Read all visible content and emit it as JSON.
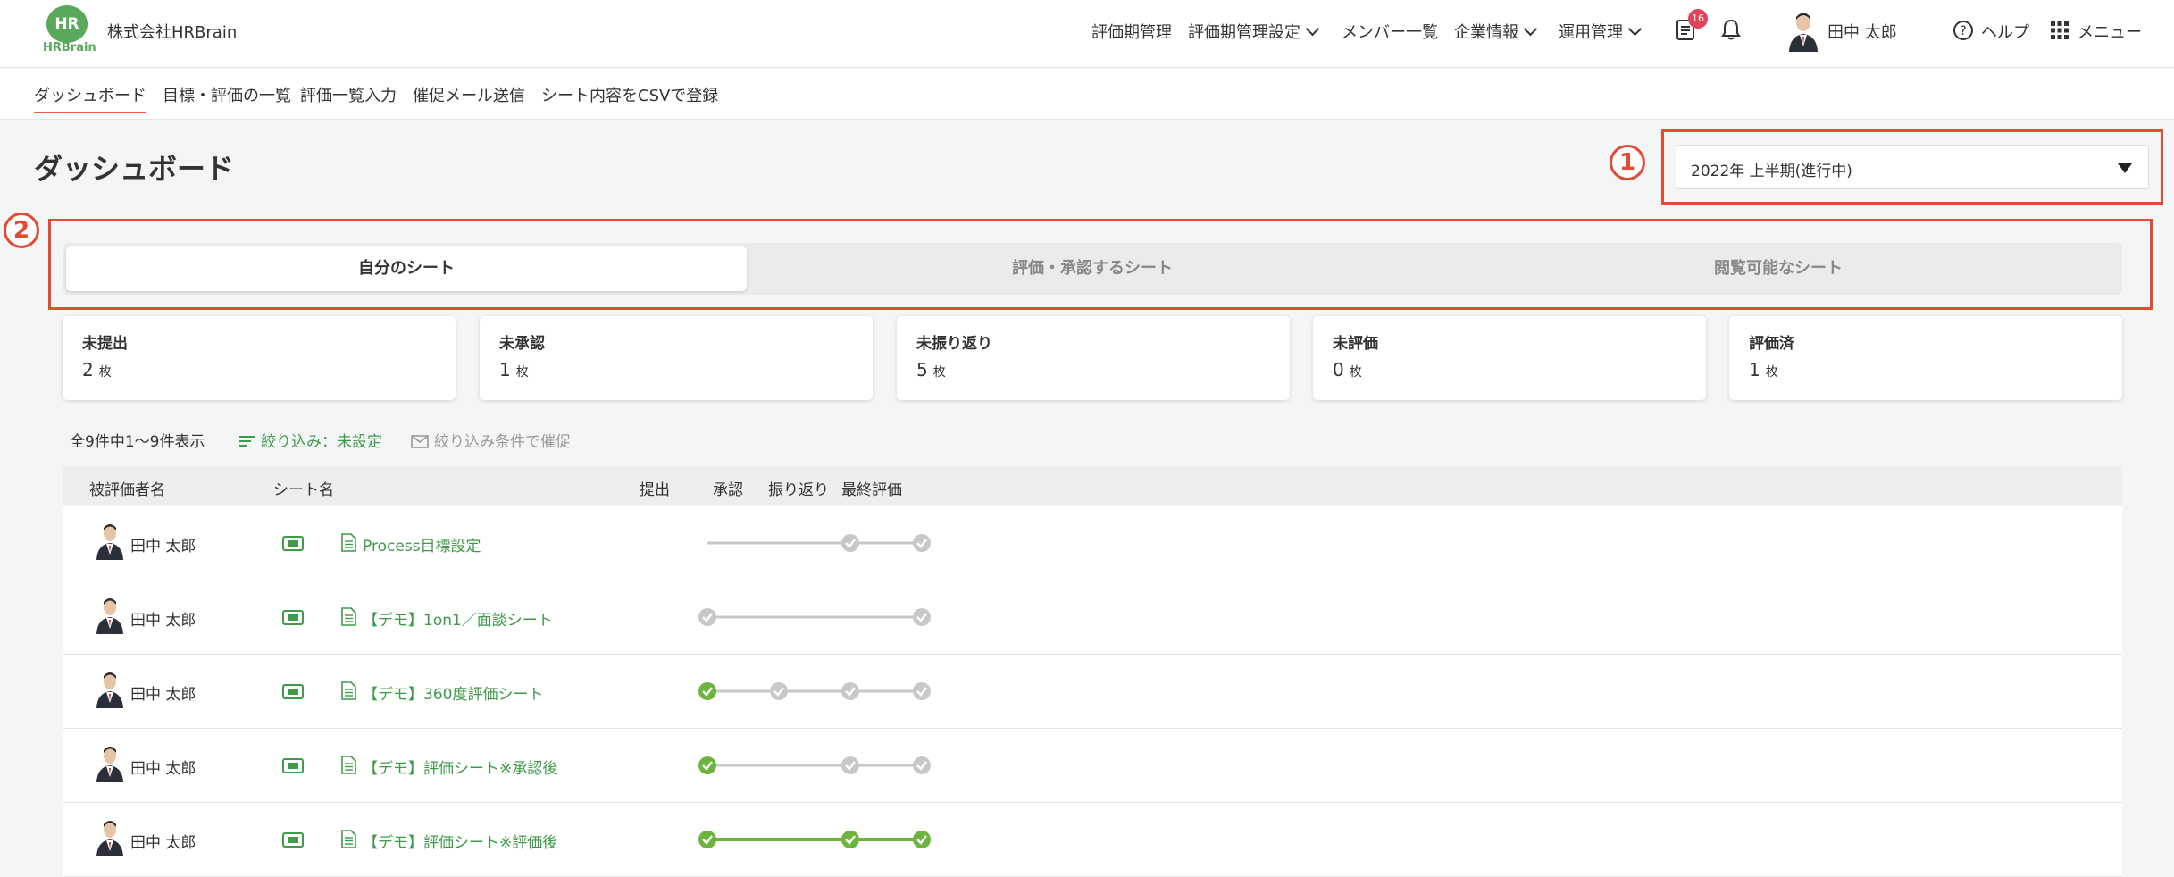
{
  "header": {
    "logo_text": "HR",
    "logo_sub": "HRBrain",
    "company": "株式会社HRBrain",
    "nav": [
      {
        "label": "評価期管理",
        "dropdown": false
      },
      {
        "label": "評価期管理設定",
        "dropdown": true
      },
      {
        "label": "メンバー一覧",
        "dropdown": false
      },
      {
        "label": "企業情報",
        "dropdown": true
      },
      {
        "label": "運用管理",
        "dropdown": true
      }
    ],
    "notification_count": "16",
    "user_name": "田中 太郎",
    "help_label": "ヘルプ",
    "menu_label": "メニュー"
  },
  "subnav": {
    "items": [
      "ダッシュボード",
      "目標・評価の一覧",
      "評価一覧入力",
      "催促メール送信",
      "シート内容をCSVで登録"
    ],
    "active": 0
  },
  "page": {
    "title": "ダッシュボード",
    "period": "2022年 上半期(進行中)"
  },
  "annotations": {
    "marker1": "1",
    "marker2": "2",
    "color": "#e24a32"
  },
  "tabs": {
    "items": [
      "自分のシート",
      "評価・承認するシート",
      "閲覧可能なシート"
    ],
    "active": 0
  },
  "summary": [
    {
      "label": "未提出",
      "count": "2",
      "unit": "枚"
    },
    {
      "label": "未承認",
      "count": "1",
      "unit": "枚"
    },
    {
      "label": "未振り返り",
      "count": "5",
      "unit": "枚"
    },
    {
      "label": "未評価",
      "count": "0",
      "unit": "枚"
    },
    {
      "label": "評価済",
      "count": "1",
      "unit": "枚"
    }
  ],
  "filters": {
    "result_count": "全9件中1〜9件表示",
    "filter_label": "絞り込み：未設定",
    "remind_label": "絞り込み条件で催促"
  },
  "table": {
    "headers": {
      "evaluatee": "被評価者名",
      "sheet": "シート名",
      "submit": "提出",
      "approve": "承認",
      "reflect": "振り返り",
      "final": "最終評価"
    },
    "rows": [
      {
        "name": "田中 太郎",
        "sheet": "Process目標設定",
        "steps": [
          "none",
          "none",
          "gray",
          "gray"
        ],
        "lines": [
          "gray",
          "gray",
          "gray"
        ]
      },
      {
        "name": "田中 太郎",
        "sheet": "【デモ】1on1／面談シート",
        "steps": [
          "gray",
          "none",
          "none",
          "gray"
        ],
        "lines": [
          "gray",
          "gray",
          "gray"
        ]
      },
      {
        "name": "田中 太郎",
        "sheet": "【デモ】360度評価シート",
        "steps": [
          "green",
          "gray",
          "gray",
          "gray"
        ],
        "lines": [
          "gray",
          "gray",
          "gray"
        ]
      },
      {
        "name": "田中 太郎",
        "sheet": "【デモ】評価シート※承認後",
        "steps": [
          "green",
          "none",
          "gray",
          "gray"
        ],
        "lines": [
          "gray",
          "gray",
          "gray"
        ]
      },
      {
        "name": "田中 太郎",
        "sheet": "【デモ】評価シート※評価後",
        "steps": [
          "green",
          "none",
          "green",
          "green"
        ],
        "lines": [
          "green",
          "green",
          "green"
        ]
      }
    ]
  },
  "colors": {
    "green": "#6db33f",
    "gray": "#c8c8c8",
    "link": "#3f9a4a",
    "accent": "#e0643c"
  }
}
